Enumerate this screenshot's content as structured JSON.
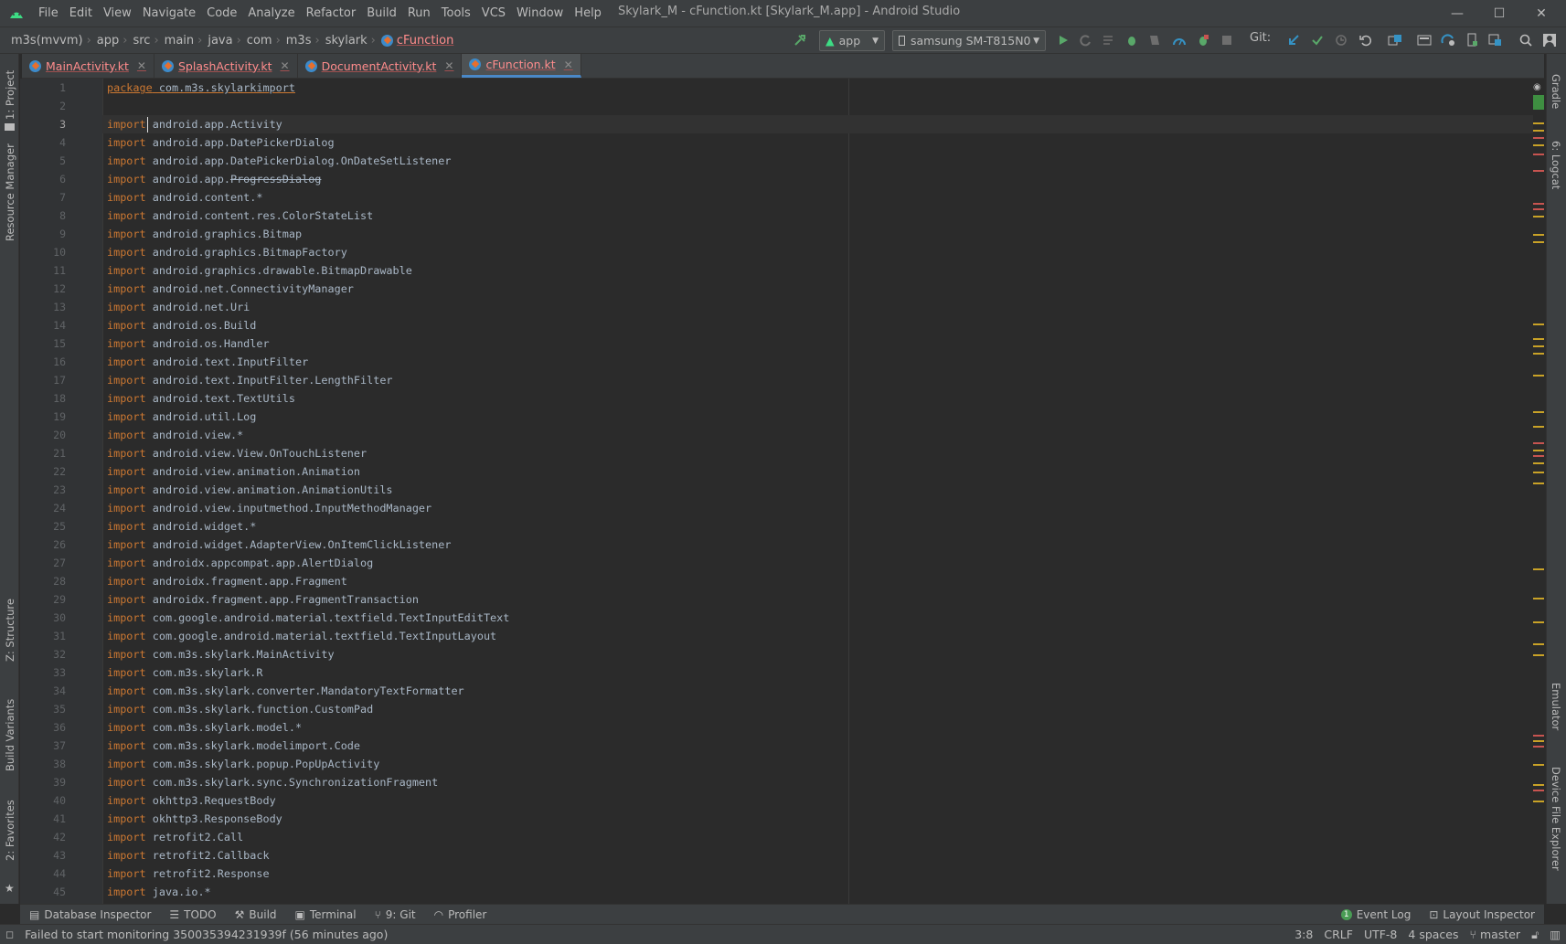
{
  "window": {
    "title": "Skylark_M - cFunction.kt [Skylark_M.app] - Android Studio",
    "minimize": "—",
    "maximize": "☐",
    "close": "✕"
  },
  "menu": [
    "File",
    "Edit",
    "View",
    "Navigate",
    "Code",
    "Analyze",
    "Refactor",
    "Build",
    "Run",
    "Tools",
    "VCS",
    "Window",
    "Help"
  ],
  "breadcrumb": [
    "m3s(mvvm)",
    "app",
    "src",
    "main",
    "java",
    "com",
    "m3s",
    "skylark",
    "cFunction"
  ],
  "toolbar": {
    "run_config": "app",
    "device": "samsung SM-T815N0",
    "git_label": "Git:"
  },
  "tabs": [
    {
      "label": "MainActivity.kt",
      "active": false
    },
    {
      "label": "SplashActivity.kt",
      "active": false
    },
    {
      "label": "DocumentActivity.kt",
      "active": false
    },
    {
      "label": "cFunction.kt",
      "active": true
    }
  ],
  "left_tool_tabs": [
    "1: Project",
    "Resource Manager",
    "Z: Structure",
    "Build Variants",
    "2: Favorites"
  ],
  "right_tool_tabs": [
    "Gradle",
    "6: Logcat",
    "Emulator",
    "Device File Explorer"
  ],
  "code": {
    "package_keyword": "package",
    "package_name": " com.m3s.skylarkimport",
    "import_keyword": "import",
    "imports": [
      "android.app.Activity",
      "android.app.DatePickerDialog",
      "android.app.DatePickerDialog.OnDateSetListener",
      "android.app.ProgressDialog",
      "android.content.*",
      "android.content.res.ColorStateList",
      "android.graphics.Bitmap",
      "android.graphics.BitmapFactory",
      "android.graphics.drawable.BitmapDrawable",
      "android.net.ConnectivityManager",
      "android.net.Uri",
      "android.os.Build",
      "android.os.Handler",
      "android.text.InputFilter",
      "android.text.InputFilter.LengthFilter",
      "android.text.TextUtils",
      "android.util.Log",
      "android.view.*",
      "android.view.View.OnTouchListener",
      "android.view.animation.Animation",
      "android.view.animation.AnimationUtils",
      "android.view.inputmethod.InputMethodManager",
      "android.widget.*",
      "android.widget.AdapterView.OnItemClickListener",
      "androidx.appcompat.app.AlertDialog",
      "androidx.fragment.app.Fragment",
      "androidx.fragment.app.FragmentTransaction",
      "com.google.android.material.textfield.TextInputEditText",
      "com.google.android.material.textfield.TextInputLayout",
      "com.m3s.skylark.MainActivity",
      "com.m3s.skylark.R",
      "com.m3s.skylark.converter.MandatoryTextFormatter",
      "com.m3s.skylark.function.CustomPad",
      "com.m3s.skylark.model.*",
      "com.m3s.skylark.modelimport.Code",
      "com.m3s.skylark.popup.PopUpActivity",
      "com.m3s.skylark.sync.SynchronizationFragment",
      "okhttp3.RequestBody",
      "okhttp3.ResponseBody",
      "retrofit2.Call",
      "retrofit2.Callback",
      "retrofit2.Response",
      "java.io.*"
    ],
    "first_line_number": 1,
    "total_lines_shown": 45
  },
  "bottom_tools": [
    "Database Inspector",
    "TODO",
    "Build",
    "Terminal",
    "9: Git",
    "Profiler"
  ],
  "bottom_right_tools": [
    "Event Log",
    "Layout Inspector"
  ],
  "event_log_count": "1",
  "status": {
    "message": "Failed to start monitoring 350035394231939f (56 minutes ago)",
    "position": "3:8",
    "line_sep": "CRLF",
    "encoding": "UTF-8",
    "indent": "4 spaces",
    "branch": "master"
  }
}
